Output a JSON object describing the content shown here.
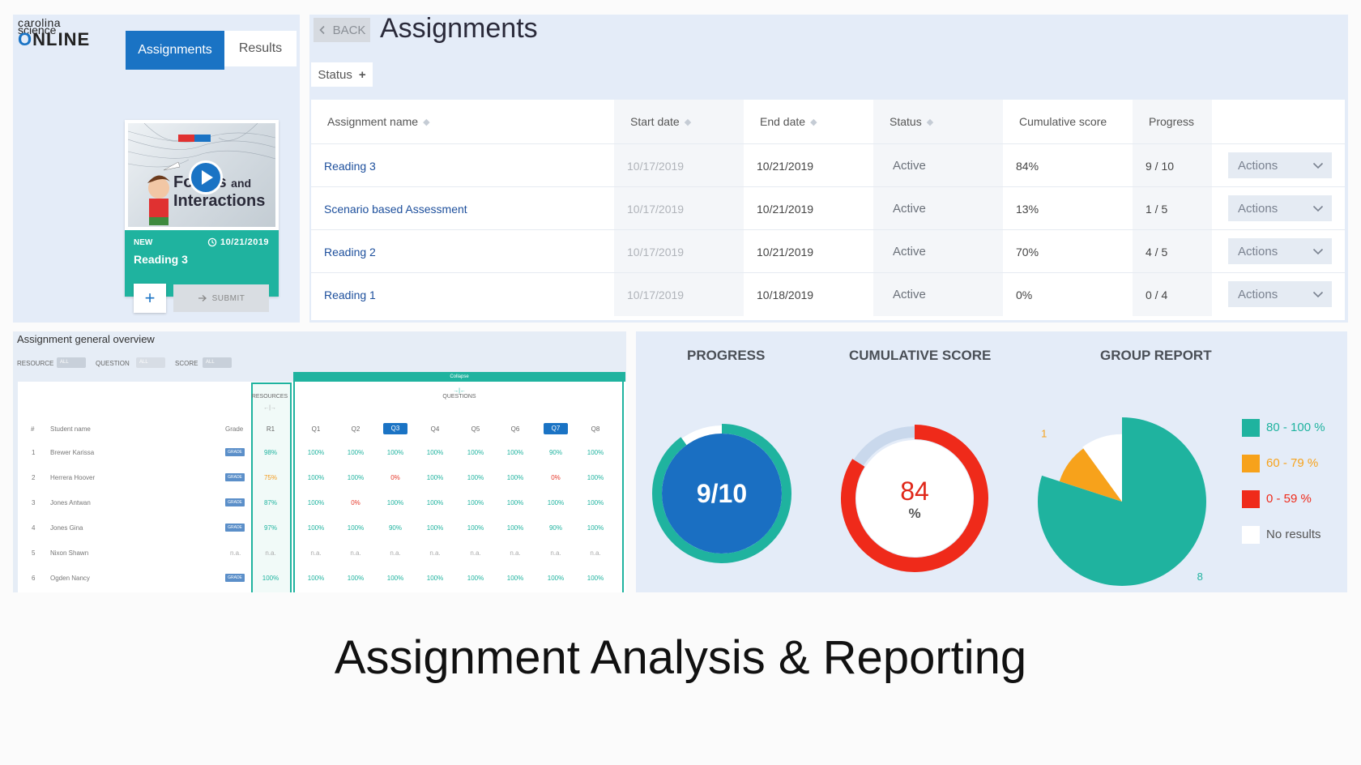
{
  "logo": {
    "line1": "carolina",
    "line2": "science",
    "line3a": "O",
    "line3b": "NLINE"
  },
  "tabs": {
    "assignments": "Assignments",
    "results": "Results"
  },
  "card": {
    "badge": "NEW",
    "date": "10/21/2019",
    "name": "Reading 3",
    "thumb_title": "Forces",
    "thumb_and": "and",
    "thumb_title2": "Interactions",
    "add_label": "+",
    "submit_label": "SUBMIT"
  },
  "header": {
    "back_label": "BACK",
    "title": "Assignments",
    "status_filter": "Status"
  },
  "table": {
    "columns": [
      "Assignment name",
      "Start date",
      "End date",
      "Status",
      "Cumulative score",
      "Progress"
    ],
    "rows": [
      {
        "name": "Reading 3",
        "start": "10/17/2019",
        "end": "10/21/2019",
        "status": "Active",
        "score": "84%",
        "progress": "9 / 10",
        "action": "Actions"
      },
      {
        "name": "Scenario based Assessment",
        "start": "10/17/2019",
        "end": "10/21/2019",
        "status": "Active",
        "score": "13%",
        "progress": "1 / 5",
        "action": "Actions"
      },
      {
        "name": "Reading 2",
        "start": "10/17/2019",
        "end": "10/21/2019",
        "status": "Active",
        "score": "70%",
        "progress": "4 / 5",
        "action": "Actions"
      },
      {
        "name": "Reading 1",
        "start": "10/17/2019",
        "end": "10/18/2019",
        "status": "Active",
        "score": "0%",
        "progress": "0 / 4",
        "action": "Actions"
      }
    ]
  },
  "overview": {
    "title": "Assignment general overview",
    "filters": [
      {
        "label": "RESOURCE",
        "value": "ALL"
      },
      {
        "label": "QUESTION",
        "value": "ALL"
      },
      {
        "label": "SCORE",
        "value": "ALL"
      }
    ],
    "collapse_label": "Collapse",
    "resources_label": "RESOURCES",
    "questions_label": "QUESTIONS",
    "col_num": "#",
    "col_student": "Student name",
    "col_grade": "Grade",
    "resource_col": "R1",
    "question_cols": [
      "Q1",
      "Q2",
      "Q3",
      "Q4",
      "Q5",
      "Q6",
      "Q7",
      "Q8"
    ],
    "selected_questions": [
      2,
      6
    ],
    "grade_btn": "GRADE",
    "students": [
      {
        "num": "1",
        "name": "Brewer Karissa",
        "grade": "GRADE",
        "r1": "98%",
        "q": [
          "100%",
          "100%",
          "100%",
          "100%",
          "100%",
          "100%",
          "90%",
          "100%"
        ]
      },
      {
        "num": "2",
        "name": "Herrera Hoover",
        "grade": "GRADE",
        "r1": "75%",
        "q": [
          "100%",
          "100%",
          "0%",
          "100%",
          "100%",
          "100%",
          "0%",
          "100%"
        ]
      },
      {
        "num": "3",
        "name": "Jones Antwan",
        "grade": "GRADE",
        "r1": "87%",
        "q": [
          "100%",
          "0%",
          "100%",
          "100%",
          "100%",
          "100%",
          "100%",
          "100%"
        ]
      },
      {
        "num": "4",
        "name": "Jones Gina",
        "grade": "GRADE",
        "r1": "97%",
        "q": [
          "100%",
          "100%",
          "90%",
          "100%",
          "100%",
          "100%",
          "90%",
          "100%"
        ]
      },
      {
        "num": "5",
        "name": "Nixon Shawn",
        "grade": "n.a.",
        "r1": "n.a.",
        "q": [
          "n.a.",
          "n.a.",
          "n.a.",
          "n.a.",
          "n.a.",
          "n.a.",
          "n.a.",
          "n.a."
        ]
      },
      {
        "num": "6",
        "name": "Ogden Nancy",
        "grade": "GRADE",
        "r1": "100%",
        "q": [
          "100%",
          "100%",
          "100%",
          "100%",
          "100%",
          "100%",
          "100%",
          "100%"
        ]
      }
    ]
  },
  "charts": {
    "progress_title": "PROGRESS",
    "score_title": "CUMULATIVE SCORE",
    "group_title": "GROUP REPORT",
    "progress_value": "9/10",
    "progress_fraction": 0.9,
    "score_value": "84",
    "score_unit": "%",
    "score_fraction": 0.84,
    "colors": {
      "teal": "#1fb39f",
      "blue": "#1a6fc2",
      "red": "#ef2a1a",
      "orange": "#f7a21b",
      "light": "#ffffff"
    }
  },
  "chart_data": {
    "type": "pie",
    "title": "GROUP REPORT",
    "categories": [
      "80 - 100 %",
      "60 - 79 %",
      "0 - 59 %",
      "No results"
    ],
    "values": [
      8,
      1,
      0,
      1
    ],
    "slice_labels": [
      "8",
      "1",
      "",
      ""
    ],
    "colors": [
      "#1fb39f",
      "#f7a21b",
      "#ef2a1a",
      "#ffffff"
    ],
    "legend_placement": "right"
  },
  "caption": "Assignment Analysis & Reporting"
}
